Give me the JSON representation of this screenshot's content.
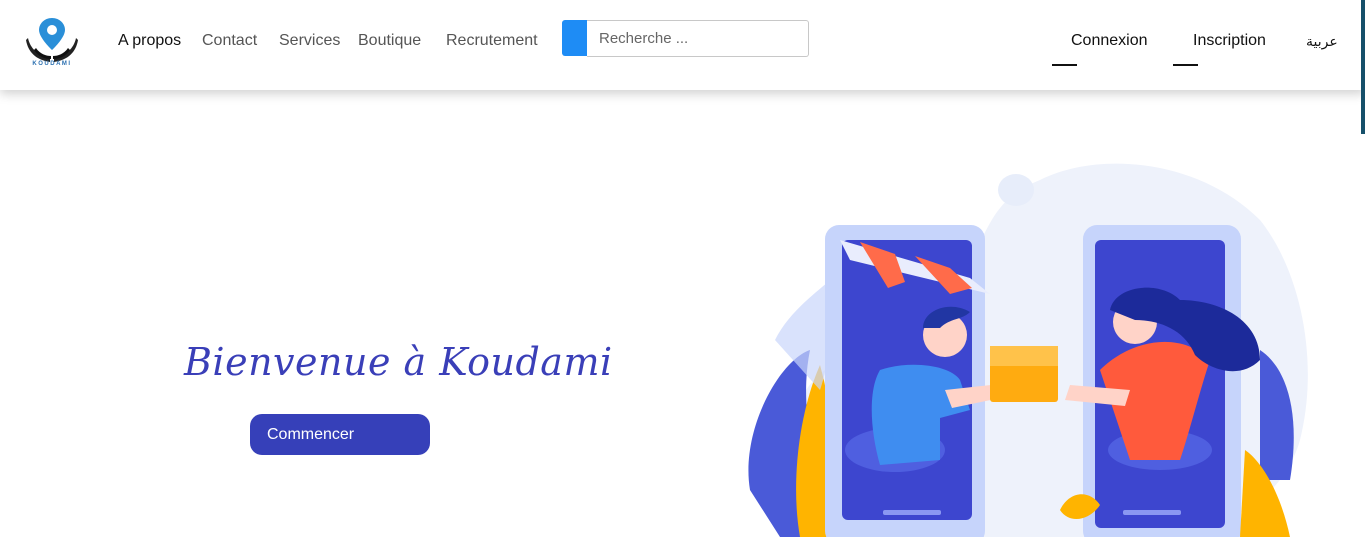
{
  "brand": {
    "logo_text": "KOUDAMI"
  },
  "nav": {
    "items": [
      {
        "label": "A propos",
        "active": true
      },
      {
        "label": "Contact",
        "active": false
      },
      {
        "label": "Services",
        "active": false
      },
      {
        "label": "Boutique",
        "active": false
      },
      {
        "label": "Recrutement",
        "active": false
      }
    ]
  },
  "search": {
    "placeholder": "Recherche ...",
    "accent_color": "#1e8cf5"
  },
  "auth": {
    "login_label": "Connexion",
    "register_label": "Inscription"
  },
  "language": {
    "label": "عربية"
  },
  "hero": {
    "title": "Bienvenue à Koudami",
    "cta_label": "Commencer",
    "accent_color": "#3640b9"
  }
}
